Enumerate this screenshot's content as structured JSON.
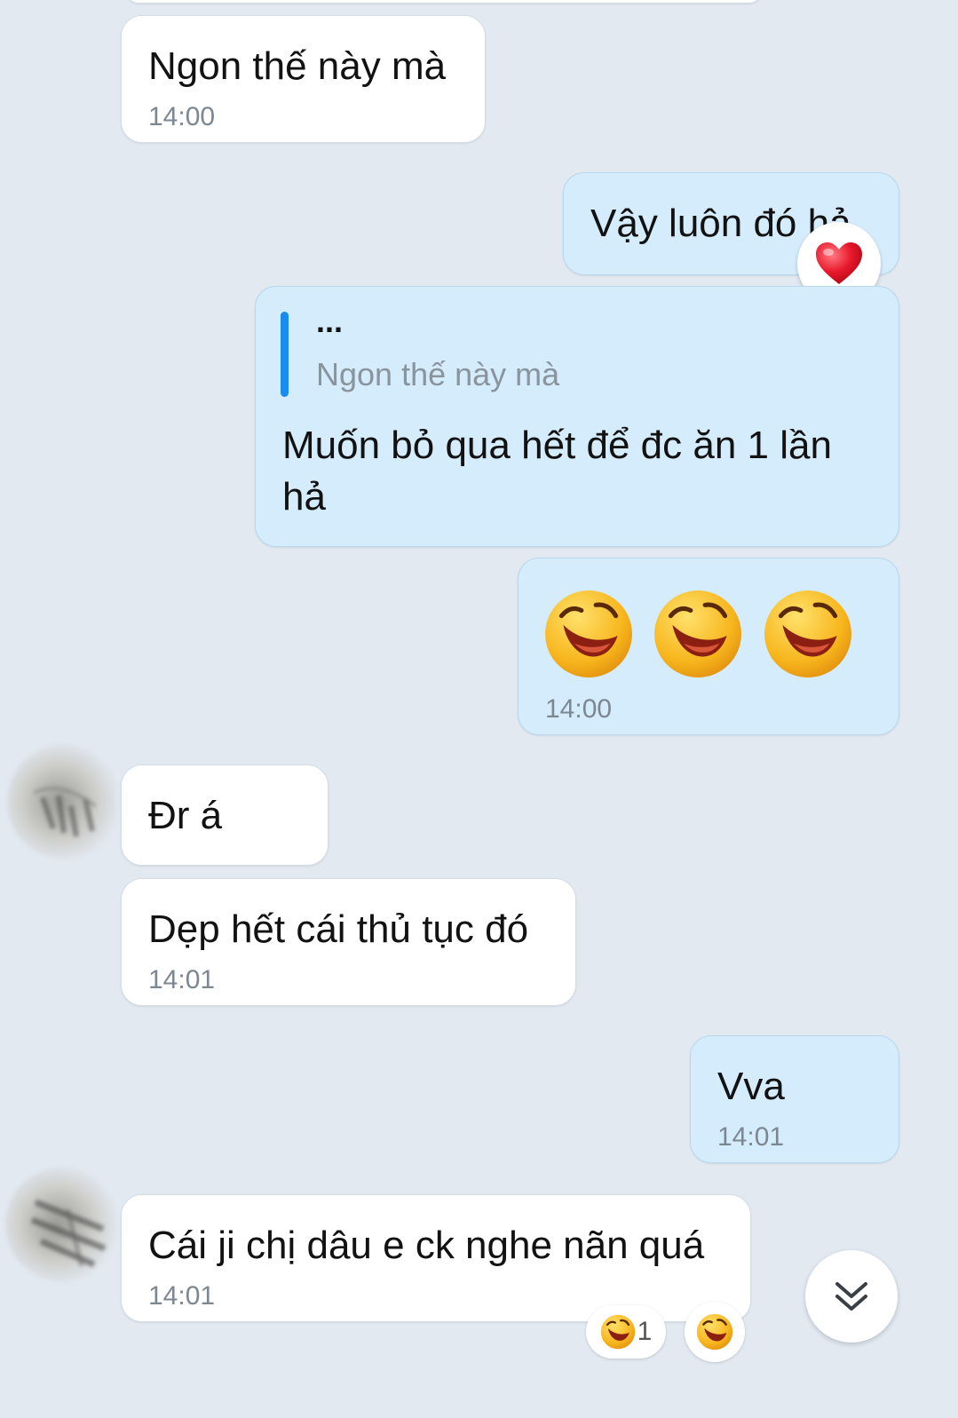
{
  "messages": {
    "m1": {
      "text": "Ngon thế này mà",
      "time": "14:00"
    },
    "m2": {
      "text": "Vậy luôn đó hả",
      "reaction": "heart-icon"
    },
    "m3": {
      "quote_sender": "...",
      "quote_text": "Ngon thế này mà",
      "text_line1": "Muốn bỏ qua hết để đc ăn 1 lần",
      "text_line2": "hả"
    },
    "m4": {
      "emoji": [
        "laughing-emoji-icon",
        "laughing-emoji-icon",
        "laughing-emoji-icon"
      ],
      "time": "14:00"
    },
    "m5": {
      "text": "Đr á"
    },
    "m6": {
      "text": "Dẹp hết cái thủ tục đó",
      "time": "14:01"
    },
    "m7": {
      "text": "Vva",
      "time": "14:01"
    },
    "m8": {
      "text": "Cái ji chị dâu e ck nghe nãn quá",
      "time": "14:01",
      "reaction_count": "1"
    }
  },
  "colors": {
    "background": "#e2e9f1",
    "incoming_bubble": "#ffffff",
    "outgoing_bubble": "#d5ecfc",
    "quote_bar": "#1a8cf0",
    "time_text": "#7c8792"
  }
}
